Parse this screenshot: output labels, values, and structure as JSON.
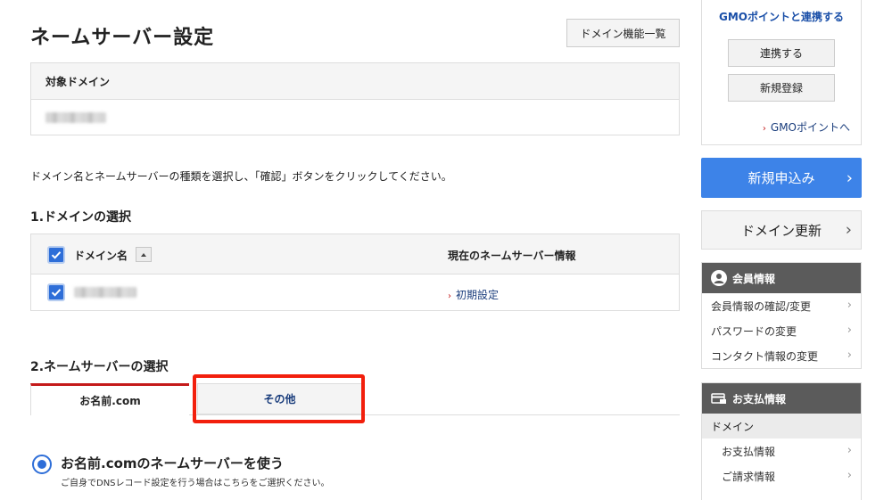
{
  "main": {
    "title": "ネームサーバー設定",
    "func_list_label": "ドメイン機能一覧",
    "target_header": "対象ドメイン",
    "instruction": "ドメイン名とネームサーバーの種類を選択し、「確認」ボタンをクリックしてください。",
    "section1_title": "1.ドメインの選択",
    "section2_title": "2.ネームサーバーの選択",
    "table": {
      "col_domain": "ドメイン名",
      "col_ns": "現在のネームサーバー情報",
      "rows": [
        {
          "ns_info": "初期設定"
        }
      ]
    },
    "tabs": [
      "お名前.com",
      "その他"
    ],
    "radio_label": "お名前.comのネームサーバーを使う",
    "radio_sub": "ご自身でDNSレコード設定を行う場合はこちらをご選択ください。"
  },
  "sidebar": {
    "gmo_title": "GMOポイントと連携する",
    "gmo_link_btn": "連携する",
    "gmo_register_btn": "新規登録",
    "gmo_point_link": "GMOポイントへ",
    "new_application": "新規申込み",
    "domain_renew": "ドメイン更新",
    "member_header": "会員情報",
    "member_items": [
      "会員情報の確認/変更",
      "パスワードの変更",
      "コンタクト情報の変更"
    ],
    "payment_header": "お支払情報",
    "payment_sub": "ドメイン",
    "payment_items": [
      "お支払情報",
      "ご請求情報"
    ]
  },
  "colors": {
    "accent_blue": "#3d83e8",
    "highlight_red": "#f21f0c",
    "tab_red": "#c41a1a"
  }
}
